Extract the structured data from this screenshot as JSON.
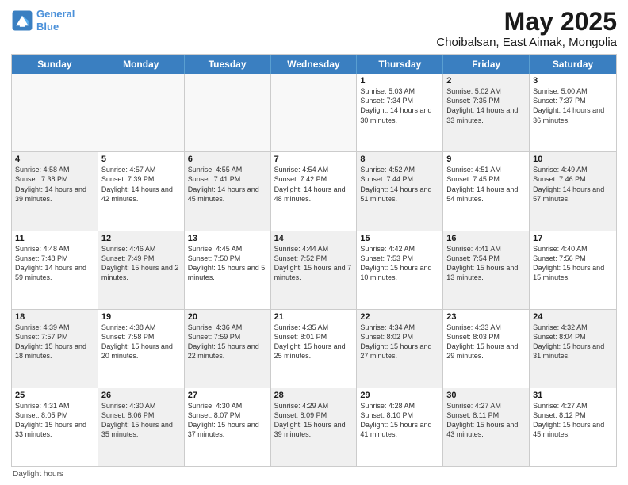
{
  "logo": {
    "line1": "General",
    "line2": "Blue"
  },
  "title": "May 2025",
  "subtitle": "Choibalsan, East Aimak, Mongolia",
  "header_days": [
    "Sunday",
    "Monday",
    "Tuesday",
    "Wednesday",
    "Thursday",
    "Friday",
    "Saturday"
  ],
  "footer": "Daylight hours",
  "weeks": [
    [
      {
        "day": "",
        "info": "",
        "empty": true
      },
      {
        "day": "",
        "info": "",
        "empty": true
      },
      {
        "day": "",
        "info": "",
        "empty": true
      },
      {
        "day": "",
        "info": "",
        "empty": true
      },
      {
        "day": "1",
        "info": "Sunrise: 5:03 AM\nSunset: 7:34 PM\nDaylight: 14 hours\nand 30 minutes."
      },
      {
        "day": "2",
        "info": "Sunrise: 5:02 AM\nSunset: 7:35 PM\nDaylight: 14 hours\nand 33 minutes.",
        "shaded": true
      },
      {
        "day": "3",
        "info": "Sunrise: 5:00 AM\nSunset: 7:37 PM\nDaylight: 14 hours\nand 36 minutes."
      }
    ],
    [
      {
        "day": "4",
        "info": "Sunrise: 4:58 AM\nSunset: 7:38 PM\nDaylight: 14 hours\nand 39 minutes.",
        "shaded": true
      },
      {
        "day": "5",
        "info": "Sunrise: 4:57 AM\nSunset: 7:39 PM\nDaylight: 14 hours\nand 42 minutes."
      },
      {
        "day": "6",
        "info": "Sunrise: 4:55 AM\nSunset: 7:41 PM\nDaylight: 14 hours\nand 45 minutes.",
        "shaded": true
      },
      {
        "day": "7",
        "info": "Sunrise: 4:54 AM\nSunset: 7:42 PM\nDaylight: 14 hours\nand 48 minutes."
      },
      {
        "day": "8",
        "info": "Sunrise: 4:52 AM\nSunset: 7:44 PM\nDaylight: 14 hours\nand 51 minutes.",
        "shaded": true
      },
      {
        "day": "9",
        "info": "Sunrise: 4:51 AM\nSunset: 7:45 PM\nDaylight: 14 hours\nand 54 minutes."
      },
      {
        "day": "10",
        "info": "Sunrise: 4:49 AM\nSunset: 7:46 PM\nDaylight: 14 hours\nand 57 minutes.",
        "shaded": true
      }
    ],
    [
      {
        "day": "11",
        "info": "Sunrise: 4:48 AM\nSunset: 7:48 PM\nDaylight: 14 hours\nand 59 minutes."
      },
      {
        "day": "12",
        "info": "Sunrise: 4:46 AM\nSunset: 7:49 PM\nDaylight: 15 hours\nand 2 minutes.",
        "shaded": true
      },
      {
        "day": "13",
        "info": "Sunrise: 4:45 AM\nSunset: 7:50 PM\nDaylight: 15 hours\nand 5 minutes."
      },
      {
        "day": "14",
        "info": "Sunrise: 4:44 AM\nSunset: 7:52 PM\nDaylight: 15 hours\nand 7 minutes.",
        "shaded": true
      },
      {
        "day": "15",
        "info": "Sunrise: 4:42 AM\nSunset: 7:53 PM\nDaylight: 15 hours\nand 10 minutes."
      },
      {
        "day": "16",
        "info": "Sunrise: 4:41 AM\nSunset: 7:54 PM\nDaylight: 15 hours\nand 13 minutes.",
        "shaded": true
      },
      {
        "day": "17",
        "info": "Sunrise: 4:40 AM\nSunset: 7:56 PM\nDaylight: 15 hours\nand 15 minutes."
      }
    ],
    [
      {
        "day": "18",
        "info": "Sunrise: 4:39 AM\nSunset: 7:57 PM\nDaylight: 15 hours\nand 18 minutes.",
        "shaded": true
      },
      {
        "day": "19",
        "info": "Sunrise: 4:38 AM\nSunset: 7:58 PM\nDaylight: 15 hours\nand 20 minutes."
      },
      {
        "day": "20",
        "info": "Sunrise: 4:36 AM\nSunset: 7:59 PM\nDaylight: 15 hours\nand 22 minutes.",
        "shaded": true
      },
      {
        "day": "21",
        "info": "Sunrise: 4:35 AM\nSunset: 8:01 PM\nDaylight: 15 hours\nand 25 minutes."
      },
      {
        "day": "22",
        "info": "Sunrise: 4:34 AM\nSunset: 8:02 PM\nDaylight: 15 hours\nand 27 minutes.",
        "shaded": true
      },
      {
        "day": "23",
        "info": "Sunrise: 4:33 AM\nSunset: 8:03 PM\nDaylight: 15 hours\nand 29 minutes."
      },
      {
        "day": "24",
        "info": "Sunrise: 4:32 AM\nSunset: 8:04 PM\nDaylight: 15 hours\nand 31 minutes.",
        "shaded": true
      }
    ],
    [
      {
        "day": "25",
        "info": "Sunrise: 4:31 AM\nSunset: 8:05 PM\nDaylight: 15 hours\nand 33 minutes."
      },
      {
        "day": "26",
        "info": "Sunrise: 4:30 AM\nSunset: 8:06 PM\nDaylight: 15 hours\nand 35 minutes.",
        "shaded": true
      },
      {
        "day": "27",
        "info": "Sunrise: 4:30 AM\nSunset: 8:07 PM\nDaylight: 15 hours\nand 37 minutes."
      },
      {
        "day": "28",
        "info": "Sunrise: 4:29 AM\nSunset: 8:09 PM\nDaylight: 15 hours\nand 39 minutes.",
        "shaded": true
      },
      {
        "day": "29",
        "info": "Sunrise: 4:28 AM\nSunset: 8:10 PM\nDaylight: 15 hours\nand 41 minutes."
      },
      {
        "day": "30",
        "info": "Sunrise: 4:27 AM\nSunset: 8:11 PM\nDaylight: 15 hours\nand 43 minutes.",
        "shaded": true
      },
      {
        "day": "31",
        "info": "Sunrise: 4:27 AM\nSunset: 8:12 PM\nDaylight: 15 hours\nand 45 minutes."
      }
    ]
  ]
}
